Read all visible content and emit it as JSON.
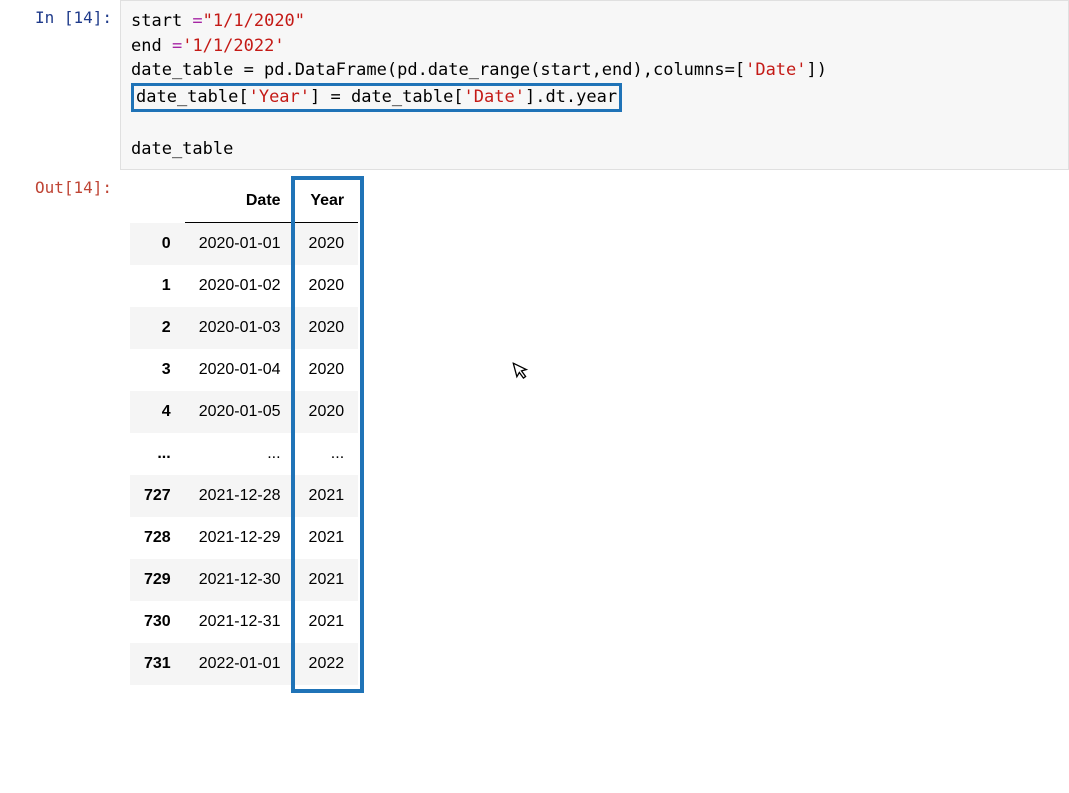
{
  "cell_in": {
    "prompt": "In [14]:",
    "code": {
      "l1a": "start ",
      "l1b": "=",
      "l1c": "\"1/1/2020\"",
      "l2a": "end ",
      "l2b": "=",
      "l2c": "'1/1/2022'",
      "l3": "date_table = pd.DataFrame(pd.date_range(start,end),columns=[",
      "l3s": "'Date'",
      "l3e": "])",
      "l4a": "date_table[",
      "l4b": "'Year'",
      "l4c": "] = date_table[",
      "l4d": "'Date'",
      "l4e": "].dt.year",
      "l6": "date_table"
    }
  },
  "cell_out": {
    "prompt": "Out[14]:",
    "table": {
      "columns": [
        "Date",
        "Year"
      ],
      "rows": [
        {
          "idx": "0",
          "date": "2020-01-01",
          "year": "2020"
        },
        {
          "idx": "1",
          "date": "2020-01-02",
          "year": "2020"
        },
        {
          "idx": "2",
          "date": "2020-01-03",
          "year": "2020"
        },
        {
          "idx": "3",
          "date": "2020-01-04",
          "year": "2020"
        },
        {
          "idx": "4",
          "date": "2020-01-05",
          "year": "2020"
        },
        {
          "idx": "...",
          "date": "...",
          "year": "..."
        },
        {
          "idx": "727",
          "date": "2021-12-28",
          "year": "2021"
        },
        {
          "idx": "728",
          "date": "2021-12-29",
          "year": "2021"
        },
        {
          "idx": "729",
          "date": "2021-12-30",
          "year": "2021"
        },
        {
          "idx": "730",
          "date": "2021-12-31",
          "year": "2021"
        },
        {
          "idx": "731",
          "date": "2022-01-01",
          "year": "2022"
        }
      ]
    }
  }
}
